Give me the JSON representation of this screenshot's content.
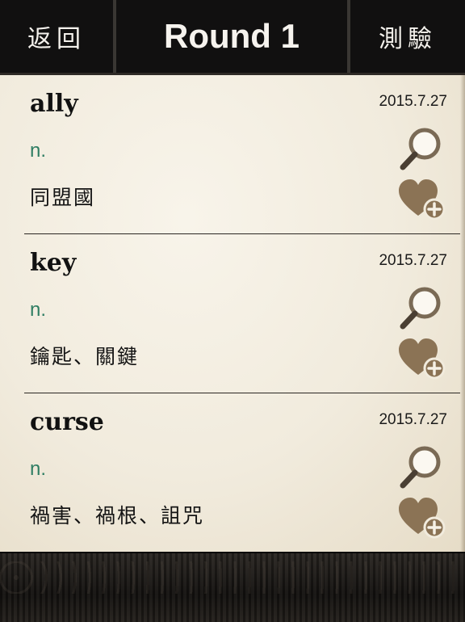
{
  "header": {
    "back_label": "返回",
    "title": "Round 1",
    "quiz_label": "測驗"
  },
  "entries": [
    {
      "word": "ally",
      "date": "2015.7.27",
      "pos": "n.",
      "meaning": "同盟國",
      "icons": [
        "search-icon",
        "favorite-add-icon"
      ]
    },
    {
      "word": "key",
      "date": "2015.7.27",
      "pos": "n.",
      "meaning": "鑰匙、關鍵",
      "icons": [
        "search-icon",
        "favorite-add-icon"
      ]
    },
    {
      "word": "curse",
      "date": "2015.7.27",
      "pos": "n.",
      "meaning": "禍害、禍根、詛咒",
      "icons": [
        "search-icon",
        "favorite-add-icon"
      ]
    }
  ],
  "colors": {
    "header_bg": "#111010",
    "paper_bg": "#f1ebdd",
    "pos_green": "#2e7d62",
    "icon_brown": "#8b7355"
  }
}
